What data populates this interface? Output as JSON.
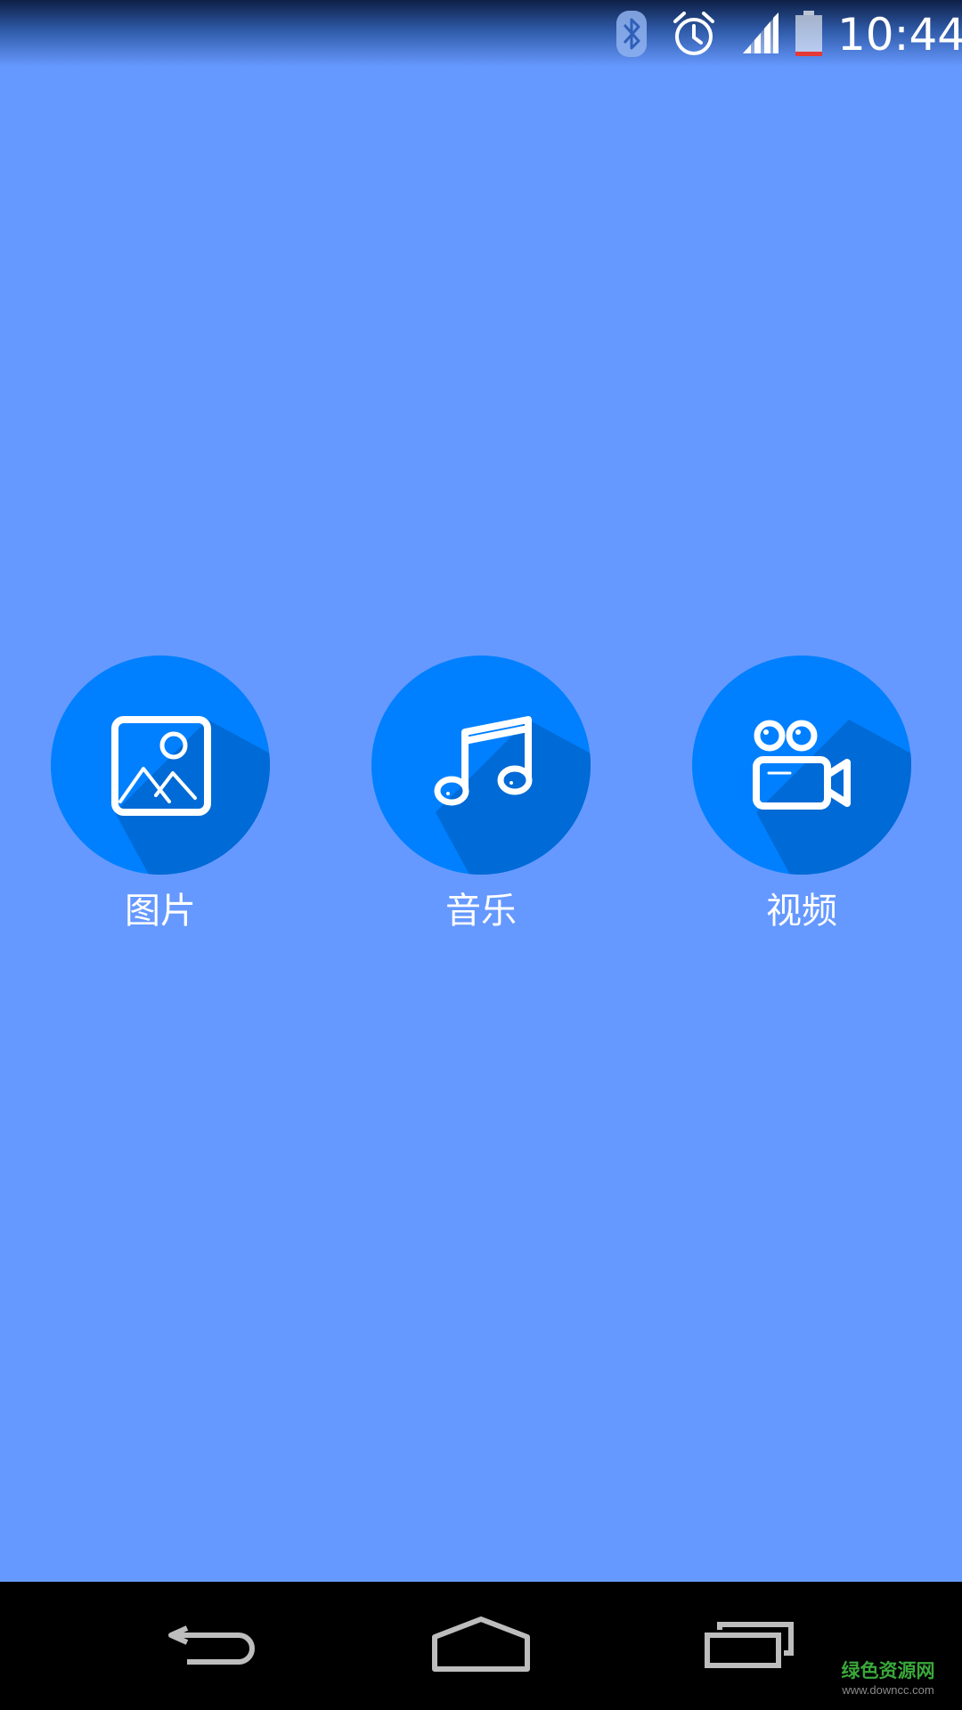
{
  "status_bar": {
    "time": "10:44",
    "icons": [
      "bluetooth-icon",
      "alarm-icon",
      "signal-icon",
      "battery-icon"
    ],
    "battery_color": "#e53935"
  },
  "menu": {
    "items": [
      {
        "label": "图片",
        "icon": "image-icon"
      },
      {
        "label": "音乐",
        "icon": "music-note-icon"
      },
      {
        "label": "视频",
        "icon": "video-camera-icon"
      }
    ],
    "circle_color": "#0080ff",
    "shadow_color": "#006ad6",
    "background": "#6699ff"
  },
  "nav_bar": {
    "buttons": [
      "back-icon",
      "home-icon",
      "recent-apps-icon"
    ]
  },
  "watermark": {
    "main": "绿色资源网",
    "url": "www.downcc.com"
  }
}
